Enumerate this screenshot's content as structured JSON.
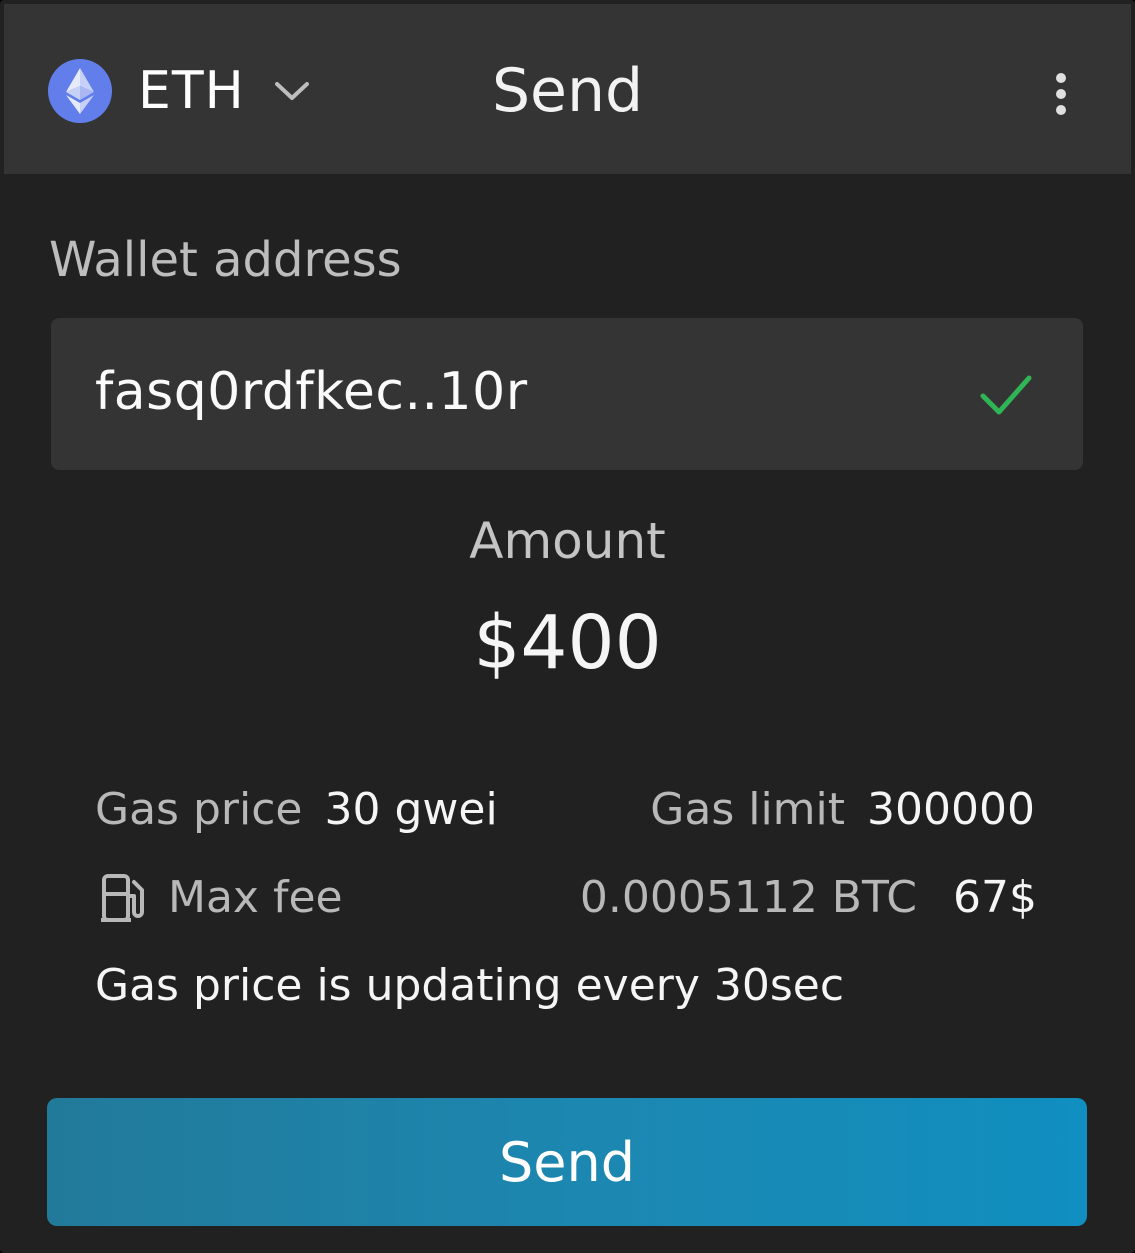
{
  "header": {
    "coin": "ETH",
    "title": "Send",
    "coin_icon": "ethereum-icon",
    "menu_icon": "more-vertical-icon"
  },
  "wallet": {
    "label": "Wallet address",
    "value": "fasq0rdfkec..10r",
    "status_icon": "check-icon"
  },
  "amount": {
    "label": "Amount",
    "value": "$400"
  },
  "gas": {
    "price_label": "Gas price",
    "price_value": "30 gwei",
    "limit_label": "Gas limit",
    "limit_value": "300000",
    "max_fee_label": "Max fee",
    "max_fee_btc": "0.0005112 BTC",
    "max_fee_usd": "67$",
    "fee_icon": "fuel-pump-icon",
    "note": "Gas price is updating every 30sec"
  },
  "actions": {
    "send_label": "Send"
  },
  "colors": {
    "background": "#212121",
    "header": "#343434",
    "field": "#343434",
    "accent_start": "#227a9a",
    "accent_end": "#108fc0",
    "success": "#2fb556",
    "eth": "#627EEA"
  }
}
